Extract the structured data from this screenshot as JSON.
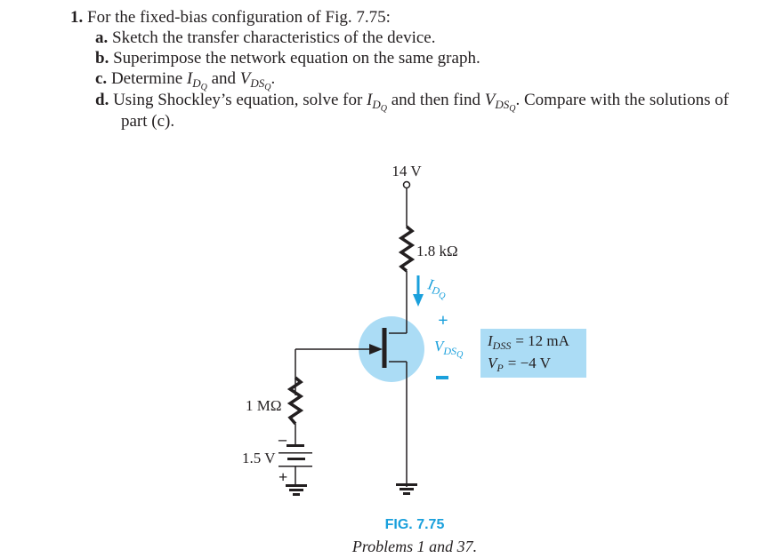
{
  "problem": {
    "number": "1.",
    "intro": "For the fixed-bias configuration of Fig. 7.75:",
    "parts": [
      {
        "label": "a.",
        "text": "Sketch the transfer characteristics of the device."
      },
      {
        "label": "b.",
        "text": "Superimpose the network equation on the same graph."
      },
      {
        "label": "c.",
        "text_before": "Determine",
        "text_mid": "and",
        "text_after": "."
      },
      {
        "label": "d.",
        "text_before": "Using Shockley’s equation, solve for",
        "text_mid": "and then find",
        "text_after": ". Compare with the solutions of",
        "continuation": "part (c)."
      }
    ],
    "symbols": {
      "I": "I",
      "D": "D",
      "Q": "Q",
      "V": "V",
      "DS": "DS"
    }
  },
  "circuit": {
    "supply_label": "14 V",
    "drain_resistor": "1.8 kΩ",
    "current_label": {
      "main": "I",
      "sub": "D",
      "subsub": "Q"
    },
    "vds_label": {
      "main": "V",
      "sub": "DS",
      "subsub": "Q"
    },
    "vds_plus": "+",
    "vds_minus": "–",
    "gate_resistor": "1 MΩ",
    "battery_label": "1.5 V",
    "battery_minus": "–",
    "battery_plus": "+",
    "params": {
      "idss_main": "I",
      "idss_sub": "DSS",
      "idss_value": "= 12 mA",
      "vp_main": "V",
      "vp_sub": "P",
      "vp_value": "= −4 V"
    },
    "colors": {
      "accent": "#1aa0dc",
      "highlight": "#abdcf5",
      "ink": "#231f20"
    }
  },
  "figure": {
    "title": "FIG. 7.75",
    "caption": "Problems 1 and 37."
  }
}
